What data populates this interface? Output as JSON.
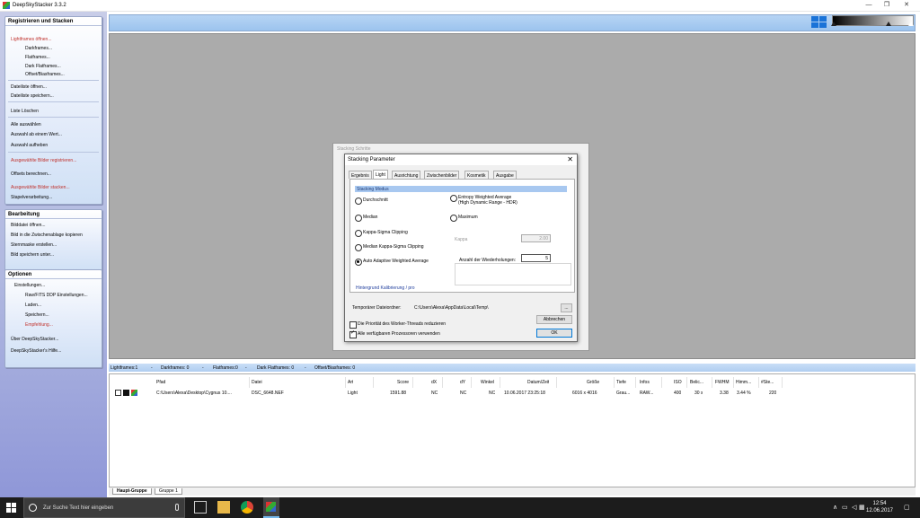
{
  "window": {
    "title": "DeepSkyStacker 3.3.2"
  },
  "sidebar": {
    "register_panel": {
      "title": "Registrieren und Stacken",
      "items": [
        {
          "label": "Lightframes öffnen..."
        },
        {
          "label": "Darkframes..."
        },
        {
          "label": "Flatframes..."
        },
        {
          "label": "Dark Flatframes..."
        },
        {
          "label": "Offset/Biasframes..."
        },
        {
          "label": "Dateiliste öffnen..."
        },
        {
          "label": "Dateiliste speichern..."
        },
        {
          "label": "Liste Löschen"
        },
        {
          "label": "Alle auswählen"
        },
        {
          "label": "Auswahl ab einem Wert..."
        },
        {
          "label": "Auswahl aufheben"
        },
        {
          "label": "Ausgewählte Bilder registrieren..."
        },
        {
          "label": "Offsets berechnen..."
        },
        {
          "label": "Ausgewählte Bilder stacken..."
        },
        {
          "label": "Stapelverarbeitung..."
        }
      ]
    },
    "edit_panel": {
      "title": "Bearbeitung",
      "items": [
        {
          "label": "Bilddatei öffnen..."
        },
        {
          "label": "Bild in die Zwischenablage kopieren"
        },
        {
          "label": "Sternmaske erstellen..."
        },
        {
          "label": "Bild speichern unter..."
        }
      ]
    },
    "options_panel": {
      "title": "Optionen",
      "items": [
        {
          "label": "Einstellungen..."
        },
        {
          "label": "Raw/FITS DDP Einstellungen..."
        },
        {
          "label": "Laden..."
        },
        {
          "label": "Speichern..."
        },
        {
          "label": "Empfehlung..."
        },
        {
          "label": "Über DeepSkyStacker..."
        },
        {
          "label": "DeepSkyStacker's Hilfe..."
        }
      ]
    }
  },
  "back_dialog": {
    "title": "Stacking Schritte"
  },
  "dialog": {
    "title": "Stacking Parameter",
    "close_glyph": "✕",
    "tabs": [
      "Ergebnis",
      "Light",
      "Ausrichtung",
      "Zwischenbilder",
      "Kosmetik",
      "Ausgabe"
    ],
    "group_title": "Stacking Modus",
    "modes": {
      "average": "Durchschnitt",
      "median": "Median",
      "kappa_sigma": "Kappa-Sigma Clipping",
      "median_kappa_sigma": "Median Kappa-Sigma Clipping",
      "auto_adaptive": "Auto Adaptive Weighted Average",
      "entropy_line1": "Entropy Weighted Average",
      "entropy_line2": "(High Dynamic Range - HDR)",
      "maximum": "Maximum"
    },
    "kappa_label": "Kappa",
    "kappa_value": "2.00",
    "iterations_label": "Anzahl der Wiederholungen:",
    "iterations_value": "5",
    "background_link": "Hintergrund Kalibrierung / pro",
    "temp_folder_label": "Temporärer Dateiordner:",
    "temp_folder_value": "C:\\Users\\Alexa\\AppData\\Local\\Temp\\",
    "browse_label": "...",
    "cancel_label": "Abbrechen",
    "ok_label": "OK",
    "thread_priority_label": "Die Priorität des Worker-Threads reduzieren",
    "all_processors_label": "Alle verfügbaren Prozessoren verwenden"
  },
  "status": {
    "lightframes": "Lightframes:1",
    "darkframes": "Darkframes: 0",
    "flatframes": "Flatframes:0",
    "dark_flatframes": "Dark Flatframes: 0",
    "offset_frames": "Offset/Biasframes: 0",
    "separator": "-"
  },
  "table": {
    "columns": [
      "Pfad",
      "Datei",
      "Art",
      "Score",
      "dX",
      "dY",
      "Winkel",
      "Datum/Zeit",
      "Größe",
      "Tiefe",
      "Infos",
      "ISO",
      "Belic...",
      "FWHM",
      "Himm...",
      "#Ste..."
    ],
    "rows": [
      {
        "path": "C:\\Users\\Alexa\\Desktop\\Cygnus 10....",
        "file": "DSC_6648.NEF",
        "type": "Light",
        "score": "1591.88",
        "dx": "NC",
        "dy": "NC",
        "angle": "NC",
        "datetime": "10.06.2017 23:25:18",
        "size": "6016 x 4016",
        "depth": "Grau...",
        "info": "RAW...",
        "iso": "400",
        "exposure": "30 s",
        "fwhm": "3.38",
        "sky": "3.44 %",
        "stars": "220"
      }
    ]
  },
  "bottom_tabs": [
    "Haupt-Gruppe",
    "Gruppe 1"
  ],
  "taskbar": {
    "search_placeholder": "Zur Suche Text hier eingeben",
    "time": "12:54",
    "date": "12.06.2017"
  },
  "colors": {
    "accent_red": "#c0302a",
    "link_blue": "#1e3c9c",
    "header_blue": "#a8c8f0",
    "windows_blue": "#1a73d8"
  }
}
